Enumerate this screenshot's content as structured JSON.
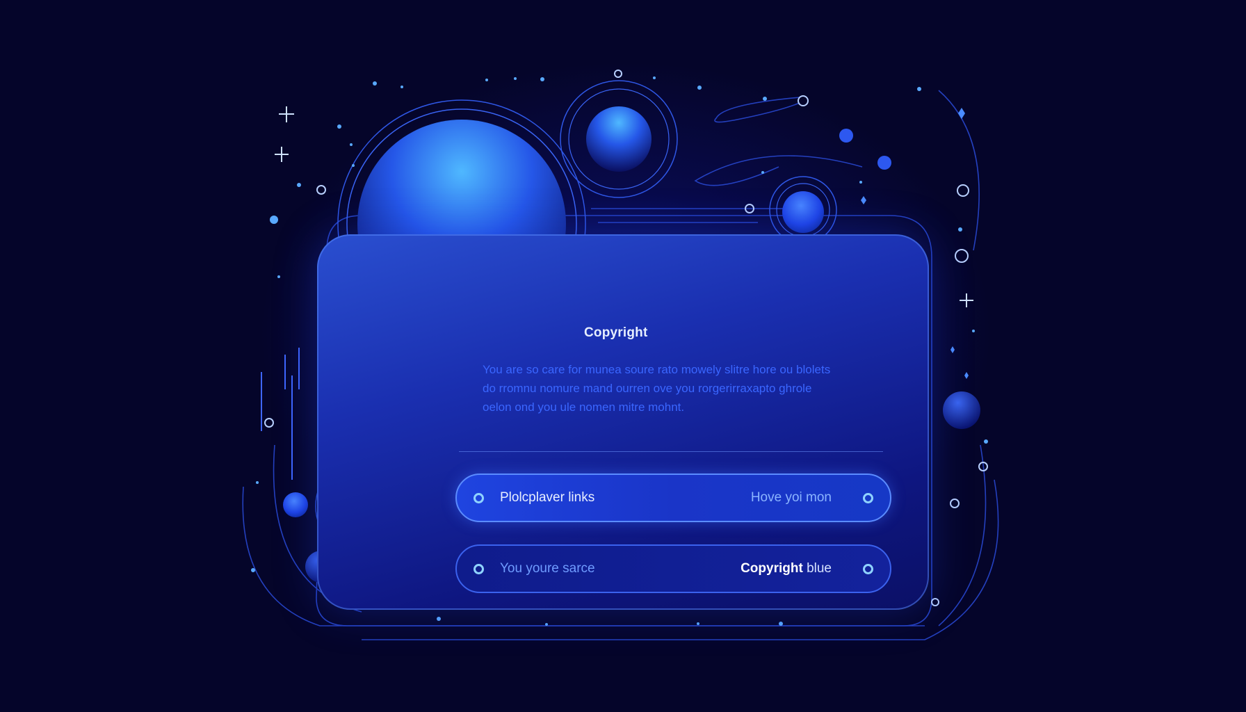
{
  "card": {
    "title": "Copyright",
    "body_lines": [
      "You are so care  for munea soure rato mowely slitre hore ou blolets",
      "do rromnu nomure mand ourren ove you rorgerirraxapto ghrole",
      "oelon ond you ule nomen mitre mohnt."
    ]
  },
  "links": [
    {
      "left_label": "Plolcplaver links",
      "right_label": "Hove yoi mon"
    },
    {
      "left_label": "You youre sarce",
      "right_label_bold": "Copyright",
      "right_label_rest": " blue"
    }
  ],
  "colors": {
    "background": "#05052a",
    "panel": "#1a2fb0",
    "accent": "#3a66ff",
    "dot": "#8fd3ff"
  }
}
